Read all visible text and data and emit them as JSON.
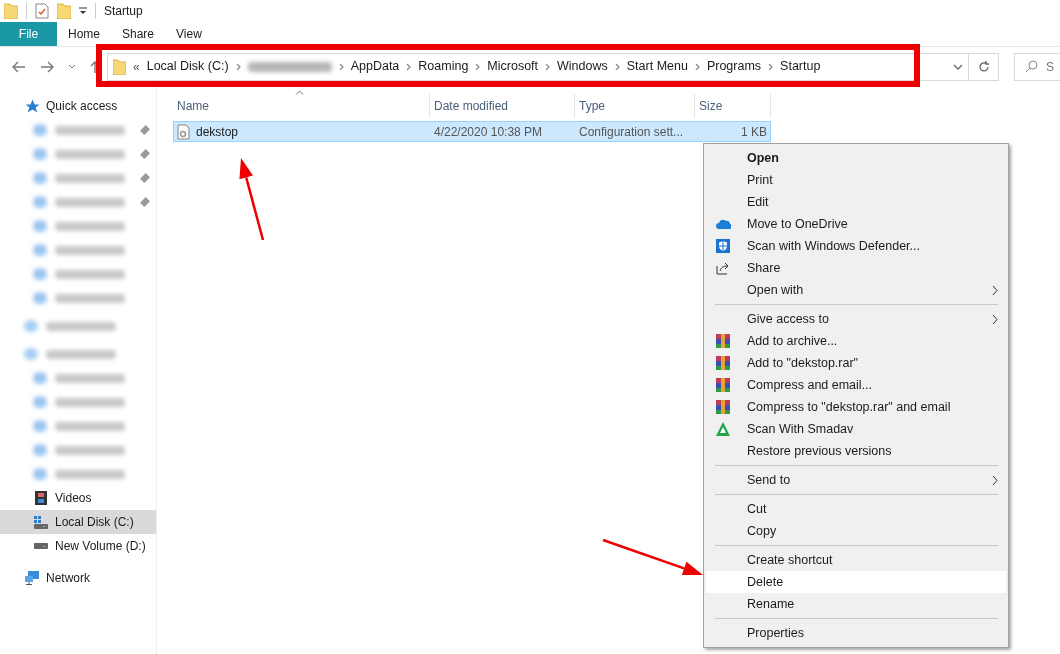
{
  "window": {
    "title": "Startup"
  },
  "ribbon_tabs": [
    {
      "label": "File",
      "selected": true
    },
    {
      "label": "Home",
      "selected": false
    },
    {
      "label": "Share",
      "selected": false
    },
    {
      "label": "View",
      "selected": false
    }
  ],
  "address_bar": {
    "overflow": "«",
    "segments": [
      {
        "label": "Local Disk (C:)",
        "blurred": false
      },
      {
        "blurred": true
      },
      {
        "label": "AppData",
        "blurred": false
      },
      {
        "label": "Roaming",
        "blurred": false
      },
      {
        "label": "Microsoft",
        "blurred": false
      },
      {
        "label": "Windows",
        "blurred": false
      },
      {
        "label": "Start Menu",
        "blurred": false
      },
      {
        "label": "Programs",
        "blurred": false
      },
      {
        "label": "Startup",
        "blurred": false
      }
    ]
  },
  "search": {
    "placeholder": "S"
  },
  "sidebar": {
    "items": [
      {
        "kind": "item",
        "label": "Quick access",
        "selected": false
      },
      {
        "kind": "blurred",
        "pinned": true
      },
      {
        "kind": "blurred",
        "pinned": true
      },
      {
        "kind": "blurred",
        "pinned": true
      },
      {
        "kind": "blurred",
        "pinned": true
      },
      {
        "kind": "blurred",
        "pinned": false
      },
      {
        "kind": "blurred",
        "pinned": false
      },
      {
        "kind": "blurred",
        "pinned": false
      },
      {
        "kind": "blurred",
        "pinned": false
      },
      {
        "kind": "blurred-group",
        "pinned": false
      },
      {
        "kind": "blurred-group",
        "pinned": false
      },
      {
        "kind": "blurred",
        "pinned": false
      },
      {
        "kind": "blurred",
        "pinned": false
      },
      {
        "kind": "blurred",
        "pinned": false
      },
      {
        "kind": "blurred",
        "pinned": false
      },
      {
        "kind": "blurred",
        "pinned": false
      },
      {
        "kind": "item",
        "label": "Videos",
        "selected": false
      },
      {
        "kind": "item",
        "label": "Local Disk (C:)",
        "selected": true
      },
      {
        "kind": "item",
        "label": "New Volume (D:)",
        "selected": false
      },
      {
        "kind": "group",
        "label": "Network",
        "selected": false
      }
    ]
  },
  "table": {
    "columns": [
      "Name",
      "Date modified",
      "Type",
      "Size"
    ],
    "rows": [
      {
        "name": "dekstop",
        "date_modified": "4/22/2020 10:38 PM",
        "type": "Configuration sett...",
        "size": "1 KB",
        "selected": true
      }
    ]
  },
  "context_menu": {
    "items": [
      {
        "kind": "item",
        "label": "Open",
        "bold": true,
        "submenu": false,
        "selected": false
      },
      {
        "kind": "item",
        "label": "Print",
        "bold": false,
        "submenu": false,
        "selected": false
      },
      {
        "kind": "item",
        "label": "Edit",
        "bold": false,
        "submenu": false,
        "selected": false
      },
      {
        "kind": "item",
        "label": "Move to OneDrive",
        "bold": false,
        "submenu": false,
        "selected": false
      },
      {
        "kind": "item",
        "label": "Scan with Windows Defender...",
        "bold": false,
        "submenu": false,
        "selected": false
      },
      {
        "kind": "item",
        "label": "Share",
        "bold": false,
        "submenu": false,
        "selected": false
      },
      {
        "kind": "item",
        "label": "Open with",
        "bold": false,
        "submenu": true,
        "selected": false
      },
      {
        "kind": "separator"
      },
      {
        "kind": "item",
        "label": "Give access to",
        "bold": false,
        "submenu": true,
        "selected": false
      },
      {
        "kind": "item",
        "label": "Add to archive...",
        "bold": false,
        "submenu": false,
        "selected": false
      },
      {
        "kind": "item",
        "label": "Add to \"dekstop.rar\"",
        "bold": false,
        "submenu": false,
        "selected": false
      },
      {
        "kind": "item",
        "label": "Compress and email...",
        "bold": false,
        "submenu": false,
        "selected": false
      },
      {
        "kind": "item",
        "label": "Compress to \"dekstop.rar\" and email",
        "bold": false,
        "submenu": false,
        "selected": false
      },
      {
        "kind": "item",
        "label": "Scan With Smadav",
        "bold": false,
        "submenu": false,
        "selected": false
      },
      {
        "kind": "item",
        "label": "Restore previous versions",
        "bold": false,
        "submenu": false,
        "selected": false
      },
      {
        "kind": "separator"
      },
      {
        "kind": "item",
        "label": "Send to",
        "bold": false,
        "submenu": true,
        "selected": false
      },
      {
        "kind": "separator"
      },
      {
        "kind": "item",
        "label": "Cut",
        "bold": false,
        "submenu": false,
        "selected": false
      },
      {
        "kind": "item",
        "label": "Copy",
        "bold": false,
        "submenu": false,
        "selected": false
      },
      {
        "kind": "separator"
      },
      {
        "kind": "item",
        "label": "Create shortcut",
        "bold": false,
        "submenu": false,
        "selected": false
      },
      {
        "kind": "item",
        "label": "Delete",
        "bold": false,
        "submenu": false,
        "selected": true
      },
      {
        "kind": "item",
        "label": "Rename",
        "bold": false,
        "submenu": false,
        "selected": false
      },
      {
        "kind": "separator"
      },
      {
        "kind": "item",
        "label": "Properties",
        "bold": false,
        "submenu": false,
        "selected": false
      }
    ]
  },
  "annotations": [
    {
      "kind": "rectangle"
    },
    {
      "kind": "arrow"
    },
    {
      "kind": "arrow"
    }
  ]
}
